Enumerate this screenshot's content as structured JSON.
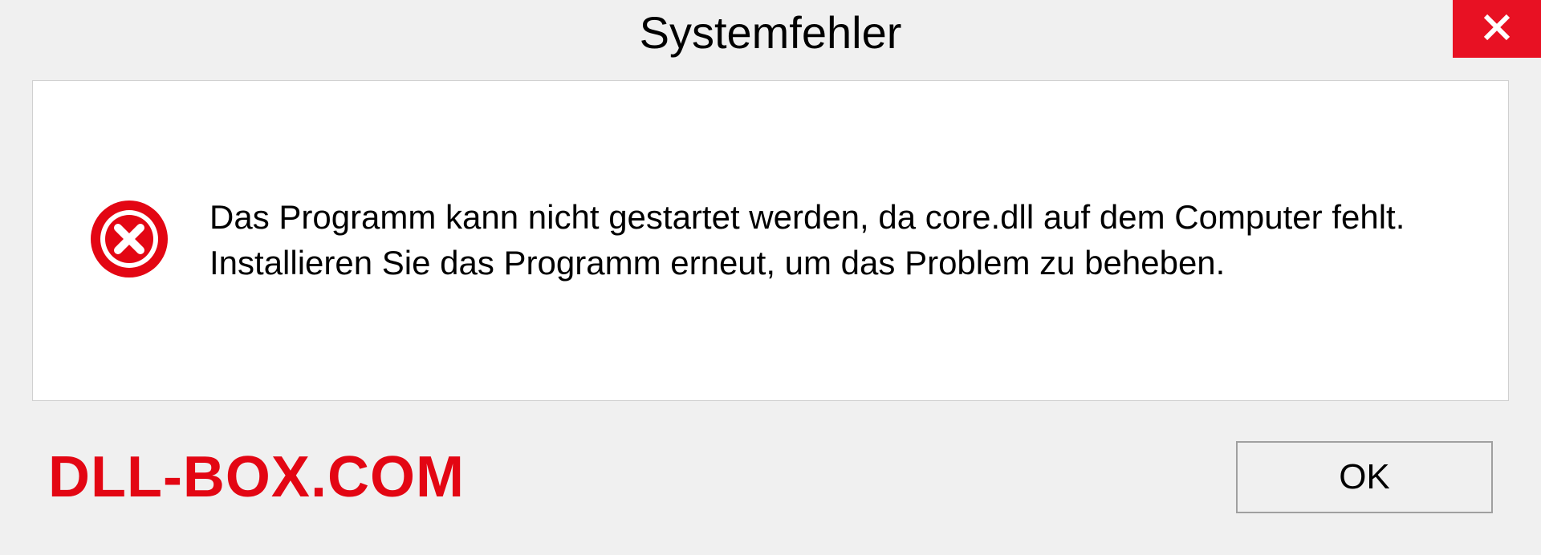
{
  "dialog": {
    "title": "Systemfehler",
    "message": "Das Programm kann nicht gestartet werden, da core.dll auf dem Computer fehlt. Installieren Sie das Programm erneut, um das Problem zu beheben.",
    "ok_label": "OK"
  },
  "watermark": {
    "text": "DLL-BOX.COM"
  }
}
